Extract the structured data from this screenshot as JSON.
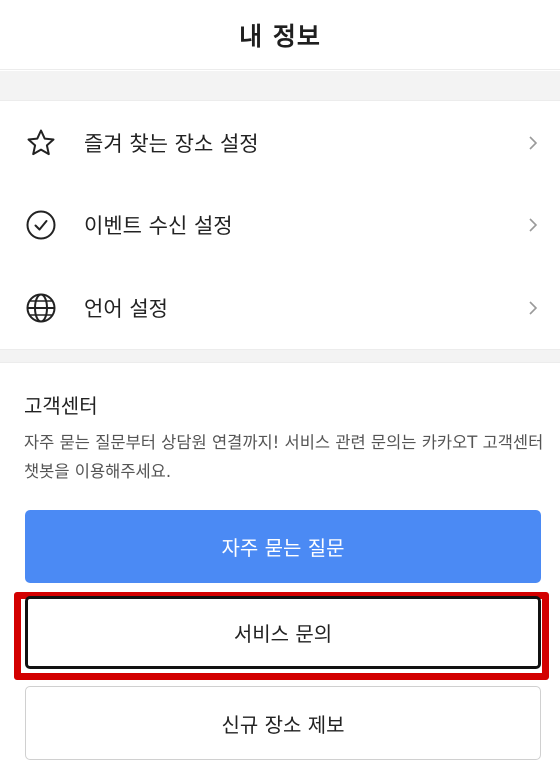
{
  "header": {
    "title": "내 정보"
  },
  "menu": {
    "items": [
      {
        "label": "즐겨 찾는 장소 설정",
        "icon": "star-icon"
      },
      {
        "label": "이벤트 수신 설정",
        "icon": "check-circle-icon"
      },
      {
        "label": "언어 설정",
        "icon": "globe-icon"
      }
    ]
  },
  "customer_center": {
    "title": "고객센터",
    "description": "자주 묻는 질문부터 상담원 연결까지! 서비스 관련 문의는 카카오T 고객센터 챗봇을 이용해주세요.",
    "buttons": {
      "faq": "자주 묻는 질문",
      "service_inquiry": "서비스 문의",
      "new_place_report": "신규 장소 제보"
    }
  },
  "colors": {
    "primary_button": "#4b8af4",
    "highlight_box": "#d30000"
  }
}
